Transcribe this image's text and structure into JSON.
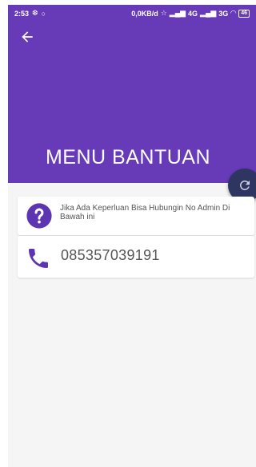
{
  "status_bar": {
    "time": "2:53",
    "net_speed": "0,0KB/d",
    "sim1": "4G",
    "sim2": "3G",
    "battery": "46"
  },
  "header": {
    "title": "MENU BANTUAN",
    "color": "#673ab7"
  },
  "help": {
    "message": "Jika Ada Keperluan Bisa Hubungin No Admin Di Bawah ini",
    "phone": "085357039191"
  },
  "fab": {
    "icon": "refresh-icon",
    "color": "#2f3561"
  }
}
